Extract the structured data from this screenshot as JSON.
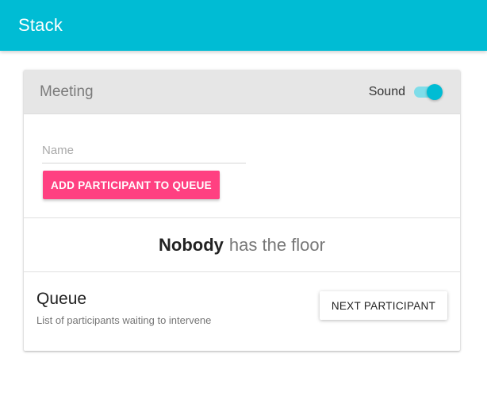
{
  "app": {
    "title": "Stack"
  },
  "meeting": {
    "title": "Meeting",
    "sound_label": "Sound",
    "sound_on": true
  },
  "form": {
    "name_placeholder": "Name",
    "name_value": "",
    "add_button_label": "ADD PARTICIPANT TO QUEUE"
  },
  "floor": {
    "holder": "Nobody",
    "suffix": "has the floor"
  },
  "queue": {
    "title": "Queue",
    "subtitle": "List of participants waiting to intervene",
    "next_button_label": "NEXT PARTICIPANT"
  },
  "colors": {
    "app_bar": "#00bcd4",
    "accent_button": "#ff4081",
    "toggle_on": "#00bcd4"
  }
}
